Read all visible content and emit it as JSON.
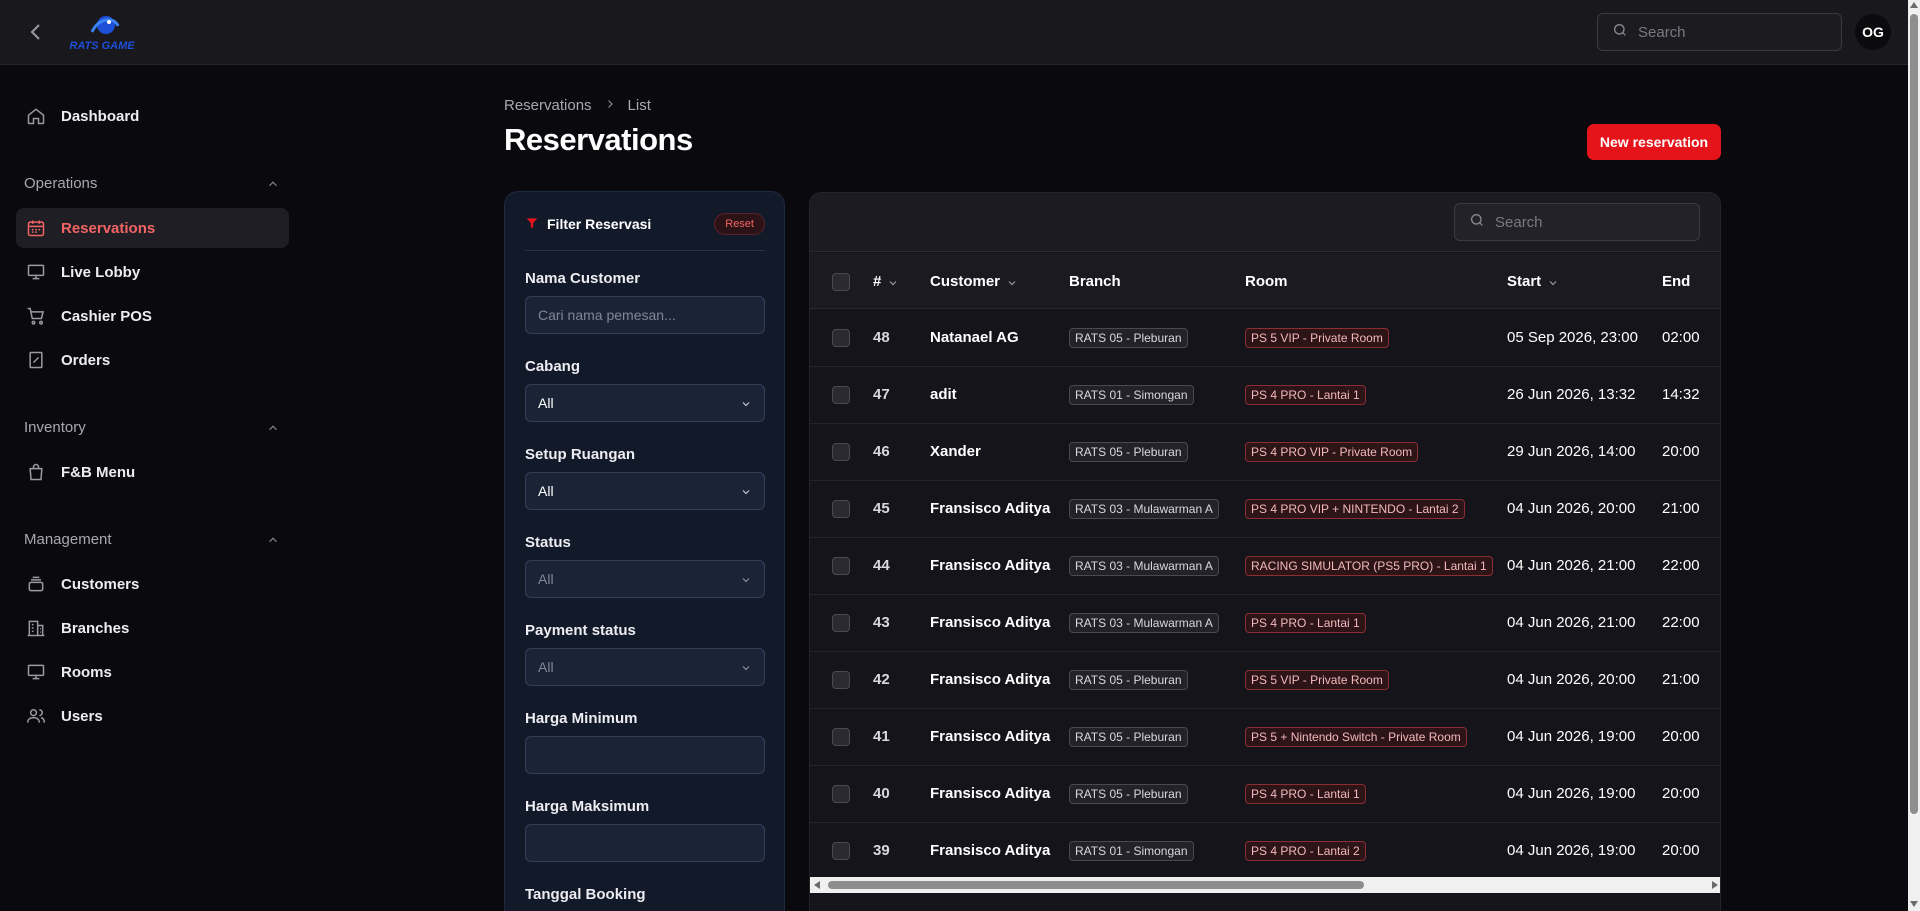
{
  "topbar": {
    "logo_text": "RATS GAME",
    "search_placeholder": "Search",
    "avatar_initials": "OG"
  },
  "sidebar": {
    "dashboard": "Dashboard",
    "groups": [
      {
        "label": "Operations",
        "items": [
          "Reservations",
          "Live Lobby",
          "Cashier POS",
          "Orders"
        ]
      },
      {
        "label": "Inventory",
        "items": [
          "F&B Menu"
        ]
      },
      {
        "label": "Management",
        "items": [
          "Customers",
          "Branches",
          "Rooms",
          "Users"
        ]
      }
    ],
    "active_item": "Reservations"
  },
  "header": {
    "breadcrumb": [
      "Reservations",
      "List"
    ],
    "title": "Reservations",
    "new_button": "New reservation"
  },
  "filter": {
    "title": "Filter Reservasi",
    "reset": "Reset",
    "fields": [
      {
        "label": "Nama Customer",
        "placeholder": "Cari nama pemesan..."
      },
      {
        "label": "Cabang",
        "value": "All"
      },
      {
        "label": "Setup Ruangan",
        "value": "All"
      },
      {
        "label": "Status",
        "value": "All"
      },
      {
        "label": "Payment status",
        "value": "All"
      },
      {
        "label": "Harga Minimum",
        "value": ""
      },
      {
        "label": "Harga Maksimum",
        "value": ""
      },
      {
        "label": "Tanggal Booking"
      }
    ]
  },
  "table": {
    "search_placeholder": "Search",
    "columns": [
      "#",
      "Customer",
      "Branch",
      "Room",
      "Start",
      "End"
    ],
    "rows": [
      {
        "id": "48",
        "customer": "Natanael AG",
        "branch": "RATS 05 - Pleburan",
        "room": "PS 5 VIP - Private Room",
        "start": "05 Sep 2026, 23:00",
        "end": "02:00"
      },
      {
        "id": "47",
        "customer": "adit",
        "branch": "RATS 01 - Simongan",
        "room": "PS 4 PRO - Lantai 1",
        "start": "26 Jun 2026, 13:32",
        "end": "14:32"
      },
      {
        "id": "46",
        "customer": "Xander",
        "branch": "RATS 05 - Pleburan",
        "room": "PS 4 PRO VIP - Private Room",
        "start": "29 Jun 2026, 14:00",
        "end": "20:00"
      },
      {
        "id": "45",
        "customer": "Fransisco Aditya",
        "branch": "RATS 03 - Mulawarman A",
        "room": "PS 4 PRO VIP + NINTENDO - Lantai 2",
        "start": "04 Jun 2026, 20:00",
        "end": "21:00"
      },
      {
        "id": "44",
        "customer": "Fransisco Aditya",
        "branch": "RATS 03 - Mulawarman A",
        "room": "RACING SIMULATOR (PS5 PRO) - Lantai 1",
        "start": "04 Jun 2026, 21:00",
        "end": "22:00"
      },
      {
        "id": "43",
        "customer": "Fransisco Aditya",
        "branch": "RATS 03 - Mulawarman A",
        "room": "PS 4 PRO - Lantai 1",
        "start": "04 Jun 2026, 21:00",
        "end": "22:00"
      },
      {
        "id": "42",
        "customer": "Fransisco Aditya",
        "branch": "RATS 05 - Pleburan",
        "room": "PS 5 VIP - Private Room",
        "start": "04 Jun 2026, 20:00",
        "end": "21:00"
      },
      {
        "id": "41",
        "customer": "Fransisco Aditya",
        "branch": "RATS 05 - Pleburan",
        "room": "PS 5 + Nintendo Switch - Private Room",
        "start": "04 Jun 2026, 19:00",
        "end": "20:00"
      },
      {
        "id": "40",
        "customer": "Fransisco Aditya",
        "branch": "RATS 05 - Pleburan",
        "room": "PS 4 PRO - Lantai 1",
        "start": "04 Jun 2026, 19:00",
        "end": "20:00"
      },
      {
        "id": "39",
        "customer": "Fransisco Aditya",
        "branch": "RATS 01 - Simongan",
        "room": "PS 4 PRO - Lantai 2",
        "start": "04 Jun 2026, 19:00",
        "end": "20:00"
      }
    ]
  },
  "colors": {
    "accent": "#e5141a",
    "active_nav_text": "#f26464",
    "background": "#0a090d",
    "filter_panel": "#121a2a"
  }
}
